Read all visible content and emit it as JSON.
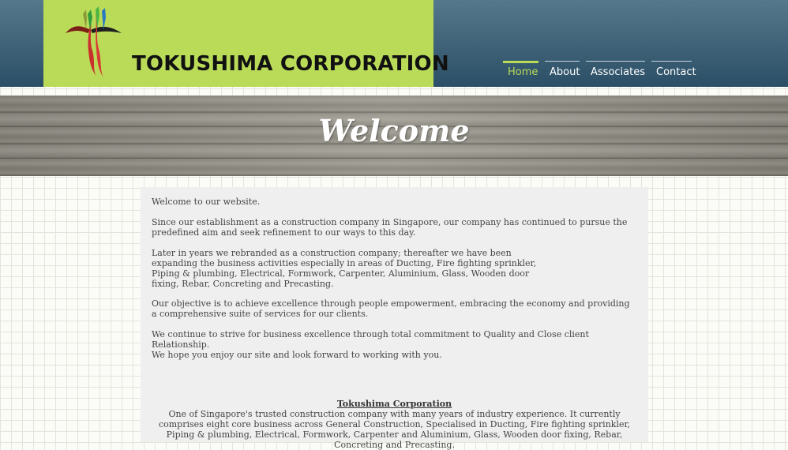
{
  "header": {
    "company_name": "TOKUSHIMA CORPORATION",
    "logo_icon": "tokushima-logo-icon",
    "nav": [
      {
        "label": "Home",
        "active": true
      },
      {
        "label": "About",
        "active": false
      },
      {
        "label": "Associates",
        "active": false
      },
      {
        "label": "Contact",
        "active": false
      }
    ]
  },
  "banner": {
    "title": "Welcome"
  },
  "content": {
    "paragraphs": [
      "Welcome to our website.",
      "Since our establishment as a construction  company in Singapore, our company has continued to pursue the predefined aim and seek refinement to our ways to this day.",
      "Later in years we rebranded as a construction company; thereafter we have been expanding the business activities especially in areas of Ducting, Fire fighting sprinkler, Piping & plumbing, Electrical, Formwork, Carpenter, Aluminium, Glass, Wooden door fixing, Rebar, Concreting and Precasting.",
      "Our objective is to achieve excellence through people empowerment, embracing the economy and providing a comprehensive suite of services for our clients.",
      "We continue to strive for business excellence through total commitment to Quality and Close client Relationship.",
      "We hope you enjoy our site and look forward to working with you."
    ],
    "footer_title": "Tokushima Corporation",
    "footer_description": "One of Singapore's trusted construction company with many years of industry experience. It currently comprises eight core business across General Construction, Specialised in Ducting, Fire fighting sprinkler, Piping & plumbing, Electrical, Formwork, Carpenter and Aluminium, Glass, Wooden door fixing, Rebar, Concreting and Precasting."
  },
  "colors": {
    "header_bg": "#3d6177",
    "logo_bg": "#badb58",
    "nav_active": "#badb58",
    "content_bg": "#efefef"
  }
}
